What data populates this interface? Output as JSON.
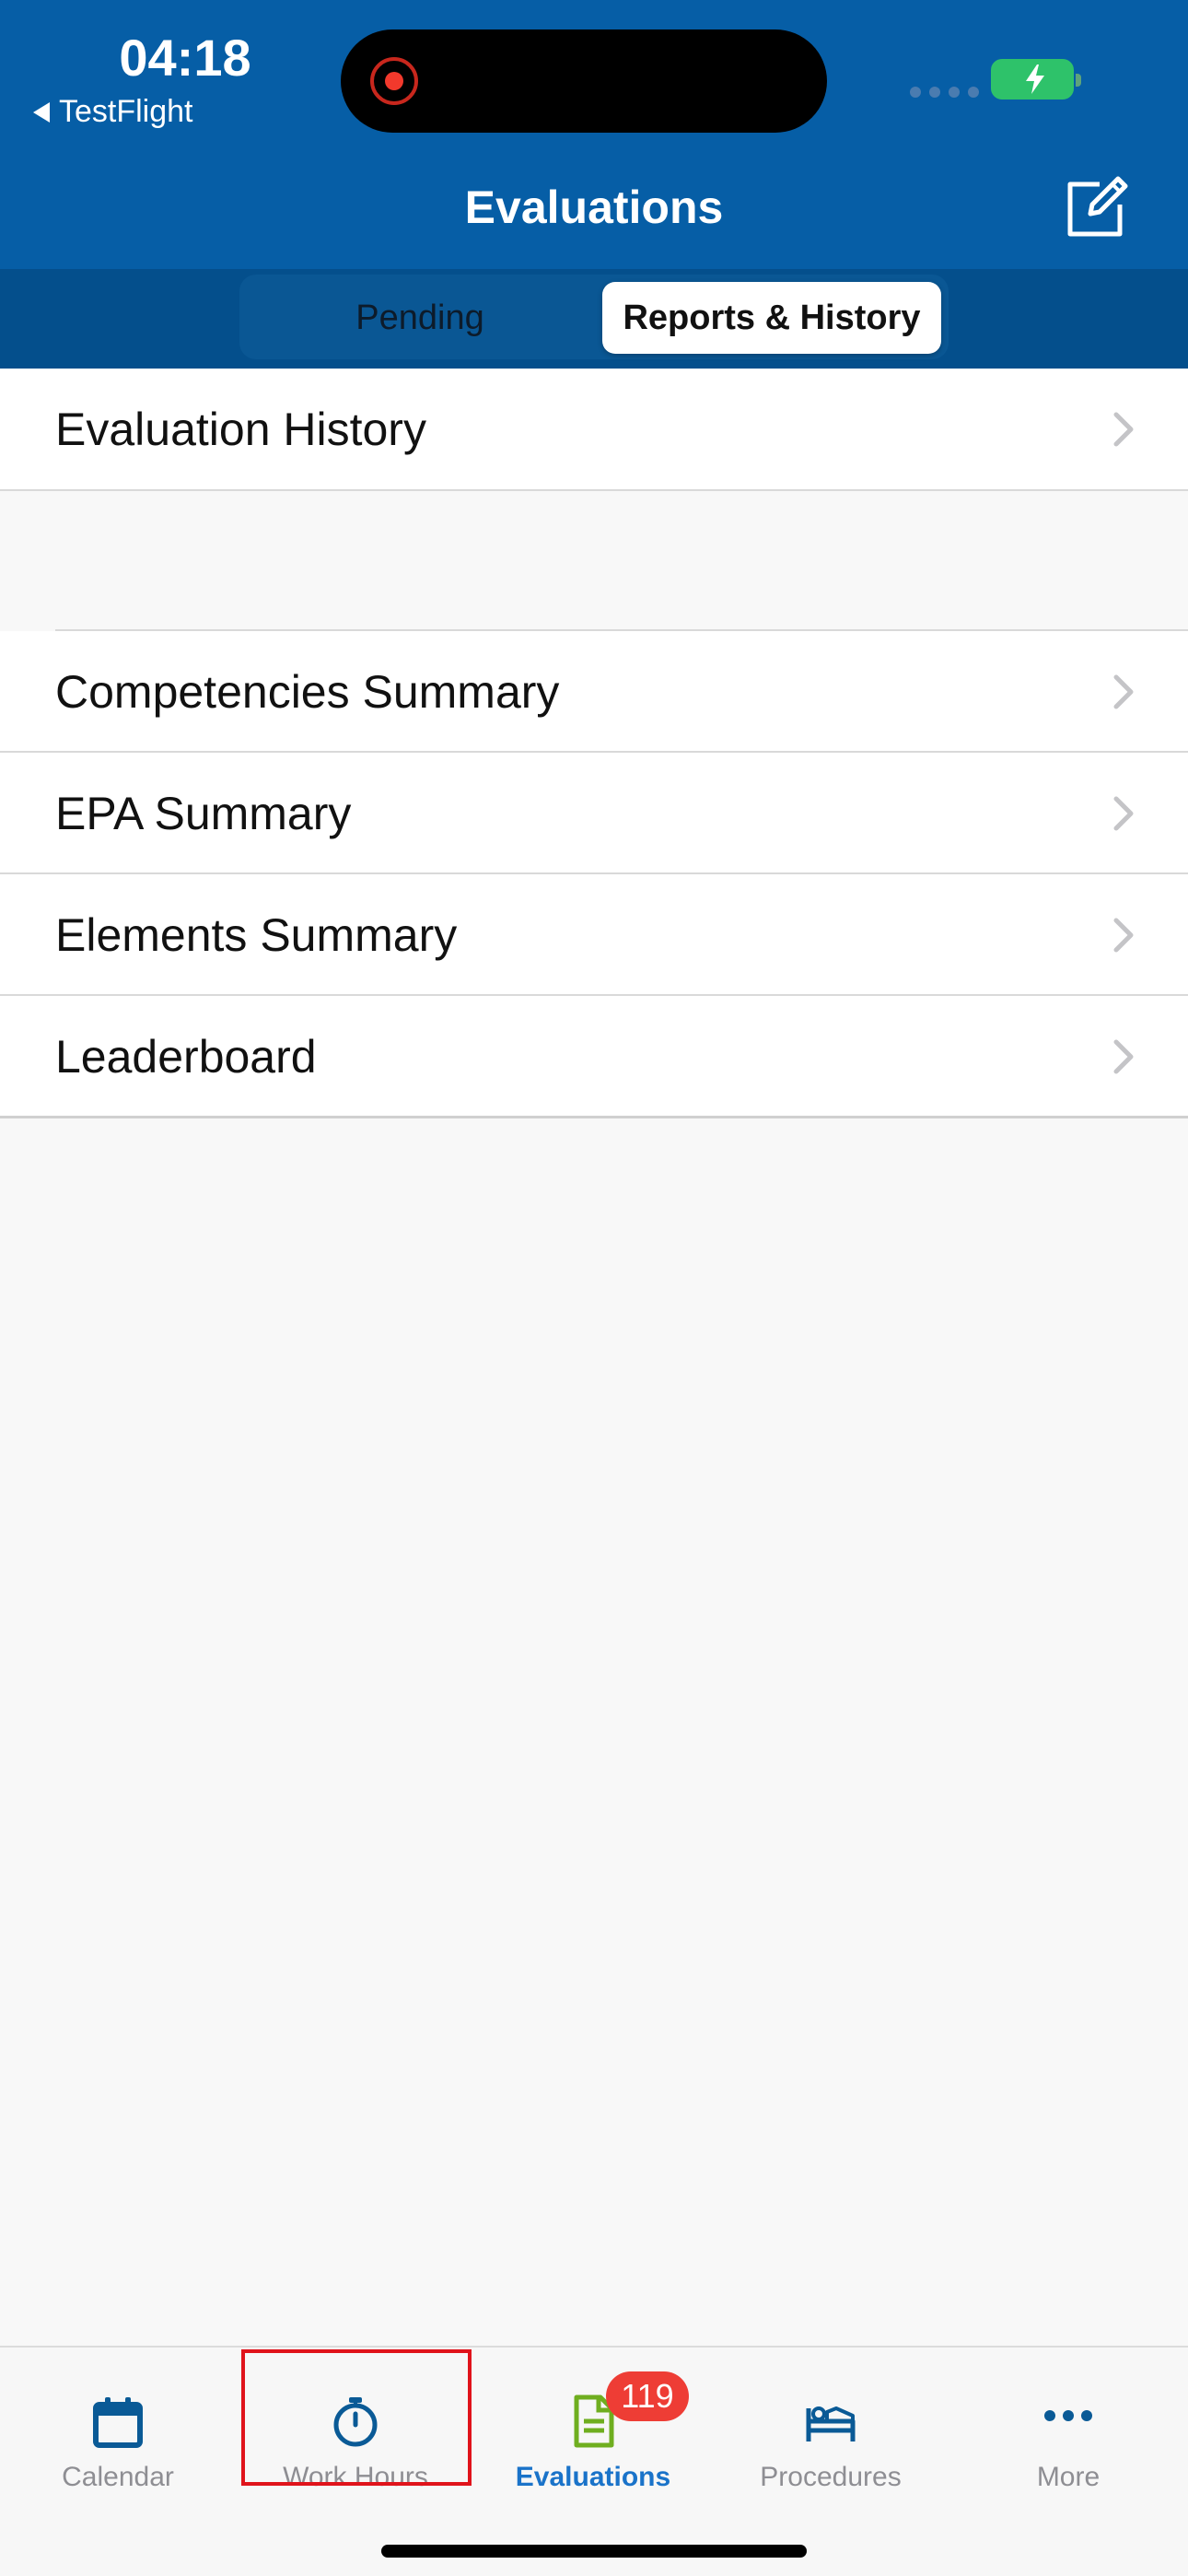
{
  "status_bar": {
    "time": "04:18",
    "back_app": "TestFlight"
  },
  "nav": {
    "title": "Evaluations",
    "compose_icon": "compose-icon"
  },
  "segments": {
    "pending": "Pending",
    "reports": "Reports & History",
    "selected": "Reports & History"
  },
  "list": {
    "history": "Evaluation History",
    "competencies": "Competencies Summary",
    "epa": "EPA Summary",
    "elements": "Elements Summary",
    "leaderboard": "Leaderboard"
  },
  "tabs": {
    "calendar": "Calendar",
    "work_hours": "Work Hours",
    "evaluations": "Evaluations",
    "evaluations_badge": "119",
    "procedures": "Procedures",
    "more": "More"
  },
  "colors": {
    "header_bg": "#065ea6",
    "segment_bar_bg": "#044f8c",
    "active_tab": "#1a73c9",
    "badge": "#ee3d35",
    "highlight": "#e0131b"
  }
}
